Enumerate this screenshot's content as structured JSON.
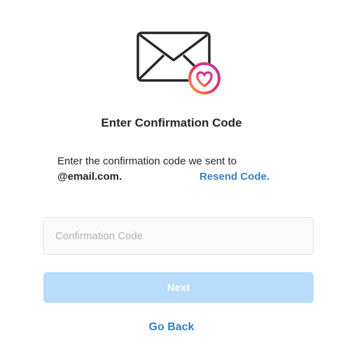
{
  "header": {
    "icon": "envelope-heart-icon",
    "title": "Enter Confirmation Code"
  },
  "description": {
    "text": "Enter the confirmation code we sent to",
    "email": "@email.com.",
    "resend_label": "Resend Code."
  },
  "form": {
    "code_placeholder": "Confirmation Code",
    "code_value": "",
    "next_label": "Next"
  },
  "footer": {
    "go_back_label": "Go Back"
  },
  "colors": {
    "link": "#3a80c4",
    "button_disabled": "#b9dcfb",
    "input_bg": "#fafafa",
    "heart_gradient_start": "#f58529",
    "heart_gradient_end": "#c13584"
  }
}
